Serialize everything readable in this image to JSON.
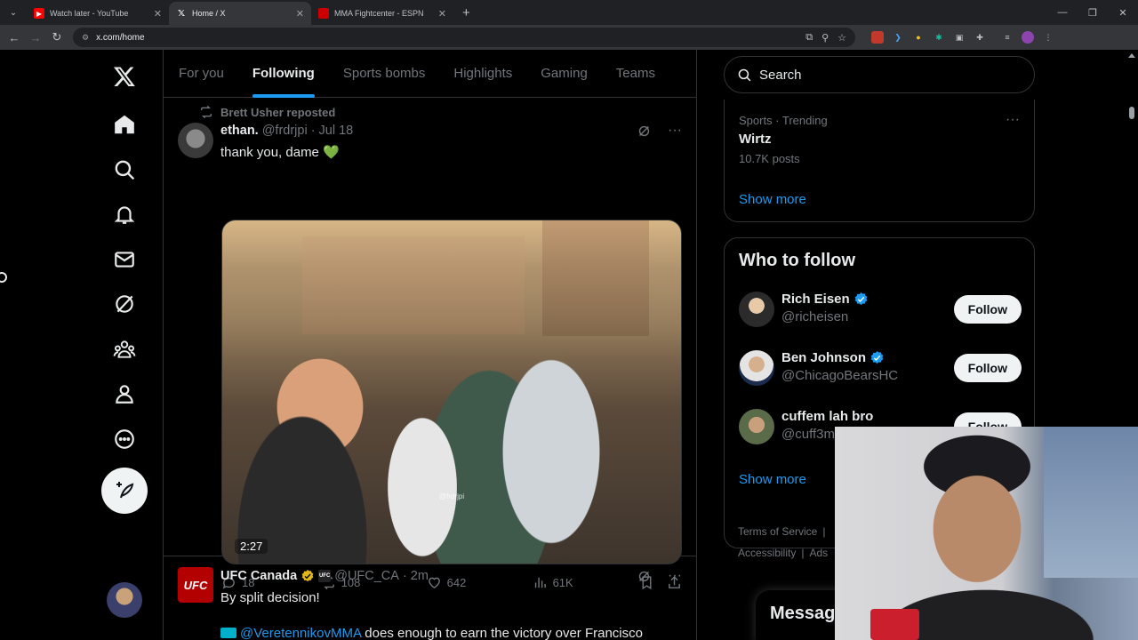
{
  "browser": {
    "tabs": [
      {
        "title": "Watch later - YouTube",
        "favicon_color": "#ff0000",
        "active": false
      },
      {
        "title": "Home / X",
        "favicon_color": "#000000",
        "active": true
      },
      {
        "title": "MMA Fightcenter - ESPN",
        "favicon_color": "#cc0000",
        "active": false
      }
    ],
    "url": "x.com/home"
  },
  "leftnav": {
    "items": [
      "x-logo",
      "home-icon",
      "search-icon",
      "bell-icon",
      "mail-icon",
      "grok-icon",
      "communities-icon",
      "profile-icon",
      "more-icon"
    ]
  },
  "feed": {
    "tabs": [
      "For you",
      "Following",
      "Sports bombs",
      "Highlights",
      "Gaming",
      "Teams"
    ],
    "active_tab": "Following",
    "posts": [
      {
        "repost_by": "Brett Usher reposted",
        "name": "ethan.",
        "handle": "@frdrjpi",
        "time": "Jul 18",
        "text": "thank you, dame 💚",
        "video_duration": "2:27",
        "video_watermark": "@frdrjpi",
        "replies": "18",
        "reposts": "108",
        "likes": "642",
        "views": "61K"
      },
      {
        "name": "UFC Canada",
        "badge_text": "UFC",
        "handle": "@UFC_CA",
        "time": "2m",
        "text": "By split decision!",
        "line2_mention": "@VeretennikovMMA",
        "line2_rest": " does enough to earn the victory over Francisco"
      }
    ]
  },
  "right": {
    "search_placeholder": "Search",
    "trend": {
      "category": "Sports · Trending",
      "name": "Wirtz",
      "count": "10.7K posts",
      "show_more": "Show more"
    },
    "who_to_follow": {
      "title": "Who to follow",
      "users": [
        {
          "name": "Rich Eisen",
          "handle": "@richeisen",
          "verified": true
        },
        {
          "name": "Ben Johnson",
          "handle": "@ChicagoBearsHC",
          "verified": true
        },
        {
          "name": "cuffem lah bro",
          "handle": "@cuff3m",
          "verified": false
        }
      ],
      "follow_label": "Follow",
      "show_more": "Show more"
    },
    "footer": [
      "Terms of Service",
      "|",
      "Accessibility",
      "|",
      "Ads"
    ],
    "messages_label": "Messag"
  },
  "colors": {
    "accent": "#1d9bf0",
    "background": "#000000",
    "border": "#2f3336",
    "muted": "#71767b"
  }
}
